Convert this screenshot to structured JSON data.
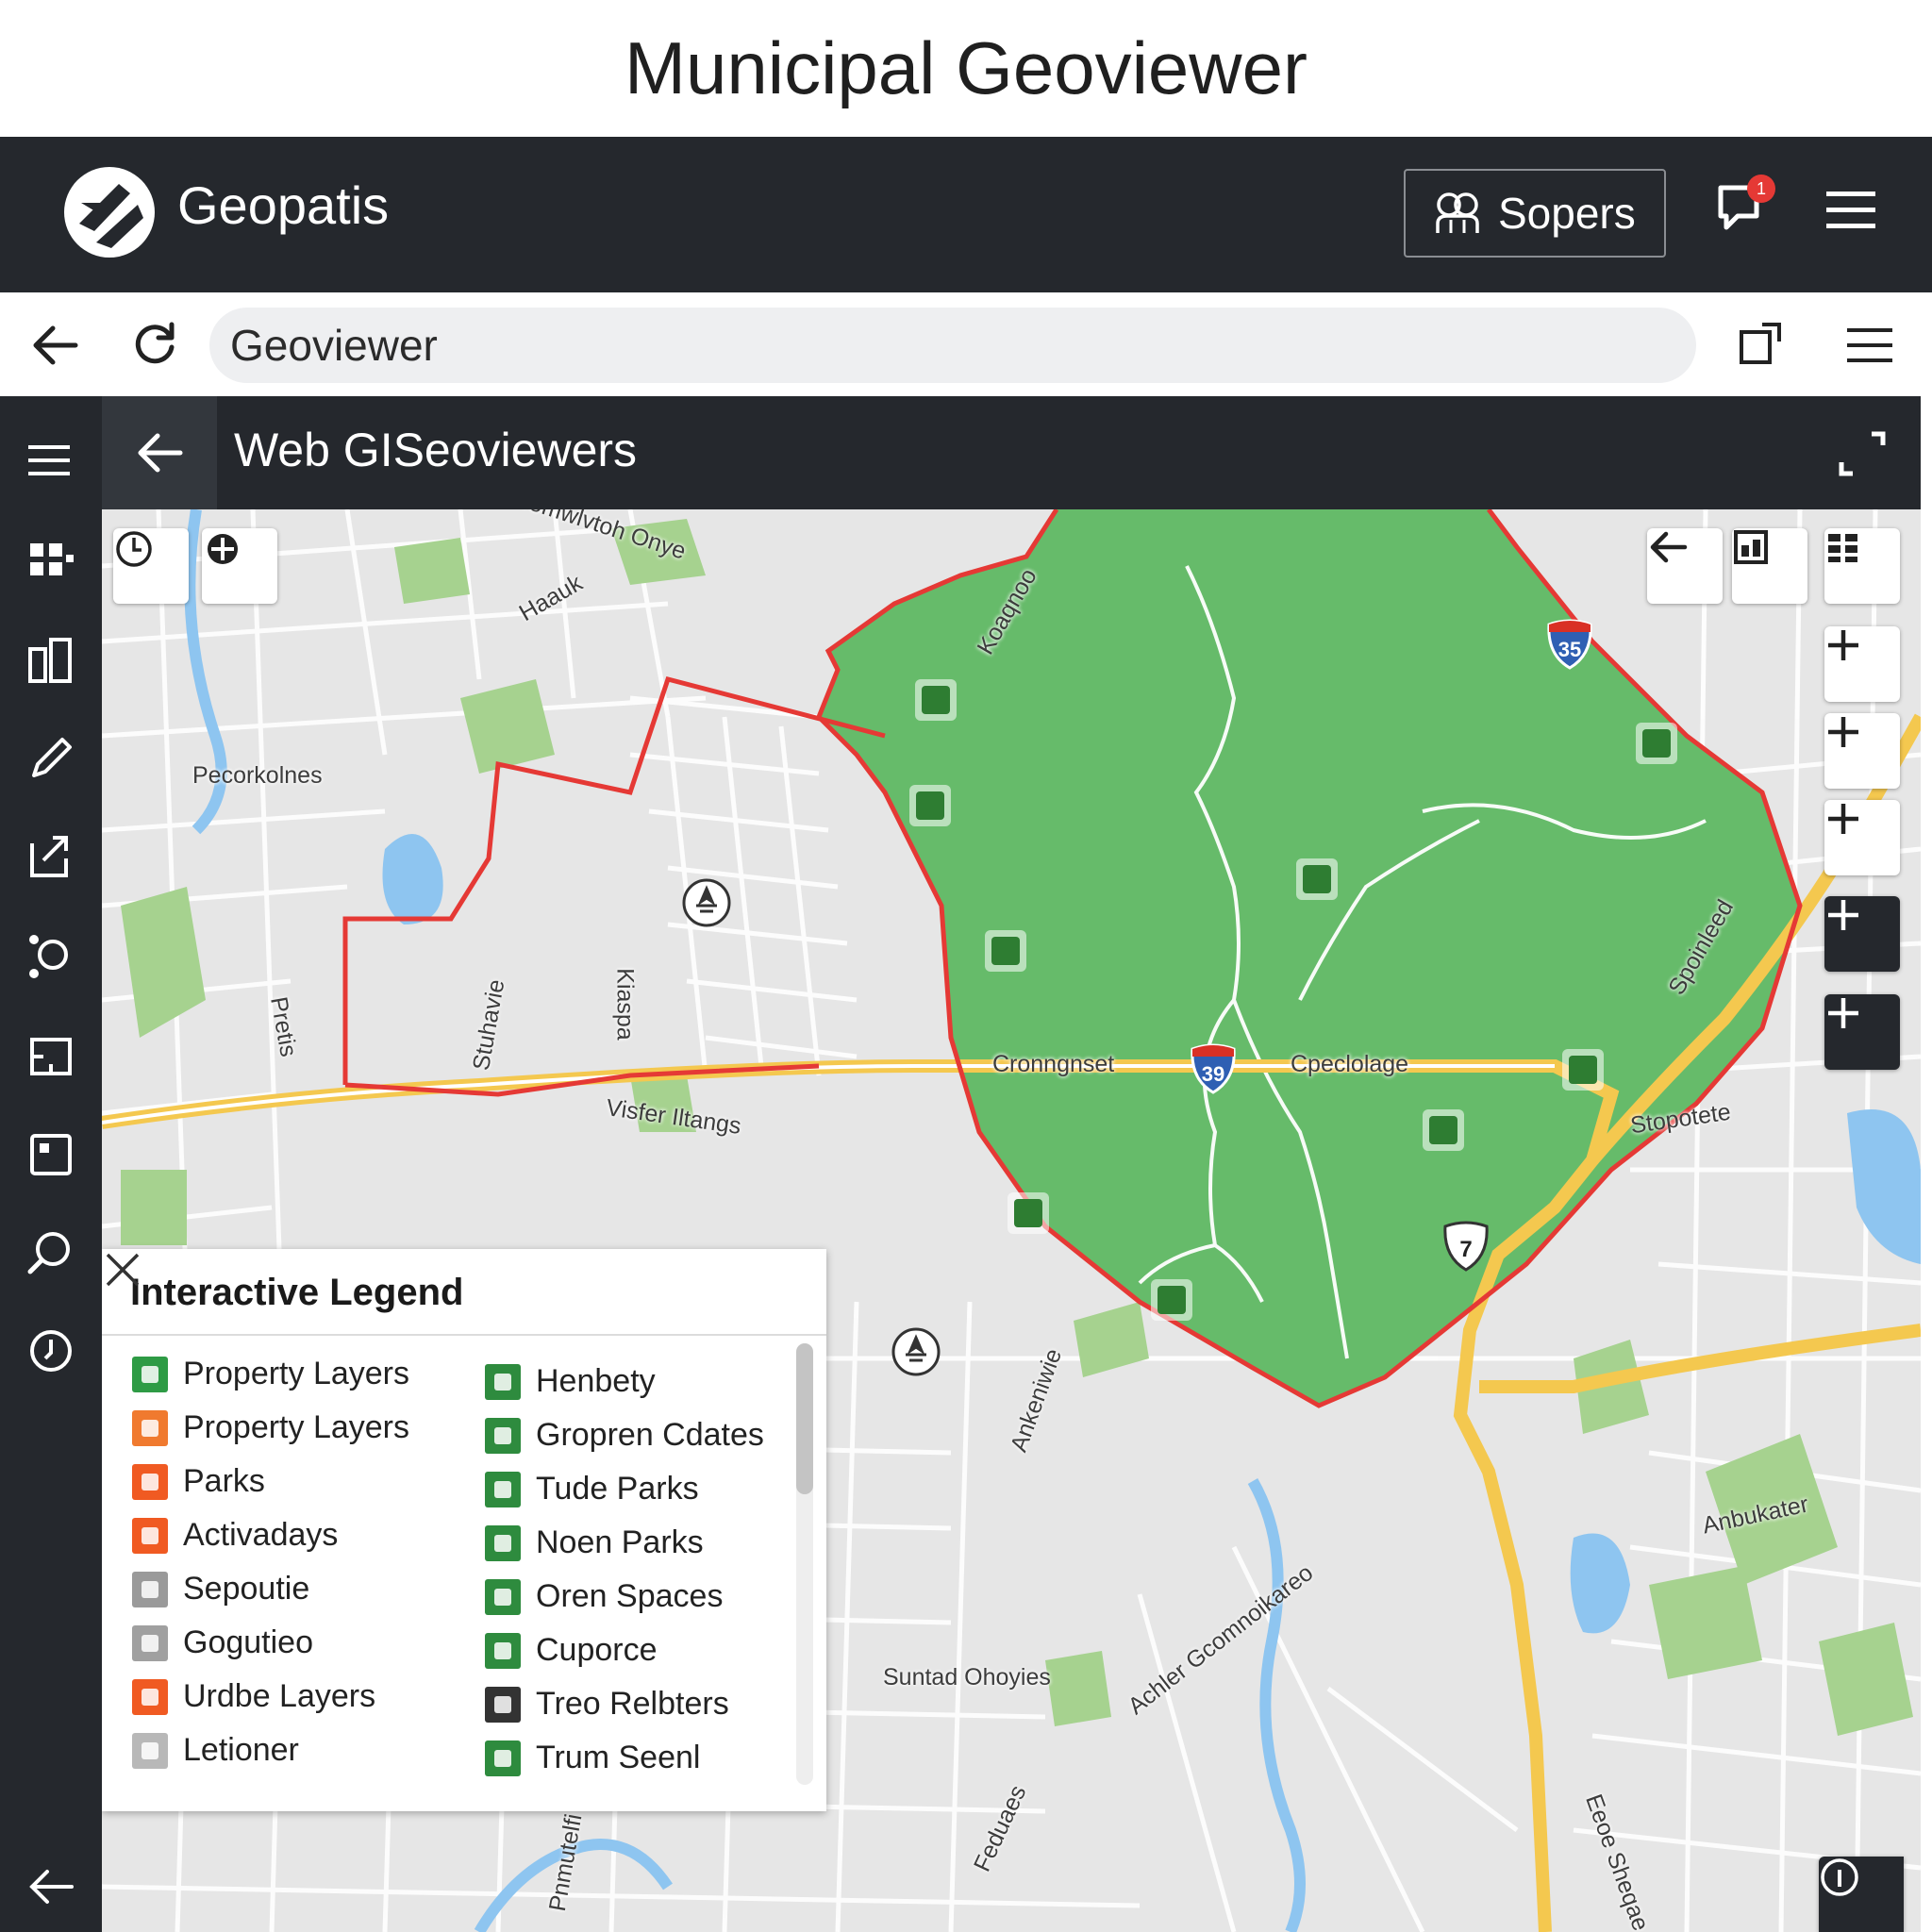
{
  "page": {
    "title": "Municipal Geoviewer"
  },
  "app": {
    "name": "Geopatis",
    "sopers_label": "Sopers",
    "notification_count": "1"
  },
  "browser": {
    "address": "Geoviewer"
  },
  "panel": {
    "title": "Web GISeoviewers"
  },
  "map": {
    "labels": [
      "Ncomwlvtoh Onye",
      "Haauk",
      "Pecorkolnes",
      "Stuhavie",
      "Kiaspa",
      "Pretis",
      "Visfer Iltangs",
      "Cronngnset",
      "Cpeclolage",
      "Stopotete",
      "Spoinleed",
      "Ankeniwie",
      "Suntad Ohoyies",
      "Achler Gcomnoikareo",
      "Anbukater",
      "Feduaes",
      "Pnmutelfi",
      "Eeoe Sheqae",
      "Koaqnoo"
    ],
    "shields": [
      "39",
      "35",
      "7"
    ],
    "colors": {
      "park": "#66bb6a",
      "boundary": "#e53935",
      "highway": "#f4c84f",
      "water": "#8ec5f0",
      "road": "#ffffff"
    }
  },
  "legend": {
    "title": "Interactive Legend",
    "left_items": [
      {
        "label": "Property Layers",
        "color": "#2e9b45",
        "icon": "plus-cross-icon"
      },
      {
        "label": "Property Layers",
        "color": "#f07a2f",
        "icon": "gear-icon"
      },
      {
        "label": "Parks",
        "color": "#f05a22",
        "icon": "bowtie-icon"
      },
      {
        "label": "Activadays",
        "color": "#f05a22",
        "icon": "ring-icon"
      },
      {
        "label": "Sepoutie",
        "color": "#9a9a9a",
        "icon": "star-icon"
      },
      {
        "label": "Gogutieo",
        "color": "#a0a0a0",
        "icon": "grid-icon"
      },
      {
        "label": "Urdbe Layers",
        "color": "#f05a22",
        "icon": "box-icon"
      },
      {
        "label": "Letioner",
        "color": "#b8b8b8",
        "icon": "square-icon"
      }
    ],
    "right_items": [
      {
        "label": "Henbety",
        "color": "#2e8b3e",
        "icon": "flag-icon"
      },
      {
        "label": "Gropren Cdates",
        "color": "#2e8b3e",
        "icon": "frame-icon"
      },
      {
        "label": "Tude Parks",
        "color": "#2e8b3e",
        "icon": "tree-icon"
      },
      {
        "label": "Noen Parks",
        "color": "#2e8b3e",
        "icon": "bench-icon"
      },
      {
        "label": "Oren Spaces",
        "color": "#2e8b3e",
        "icon": "fork-icon"
      },
      {
        "label": "Cuporce",
        "color": "#2e8b3e",
        "icon": "badge-icon"
      },
      {
        "label": "Treo Relbters",
        "color": "#333333",
        "icon": "pine-icon"
      },
      {
        "label": "Trum Seenl",
        "color": "#2e8b3e",
        "icon": "info-icon"
      }
    ]
  }
}
